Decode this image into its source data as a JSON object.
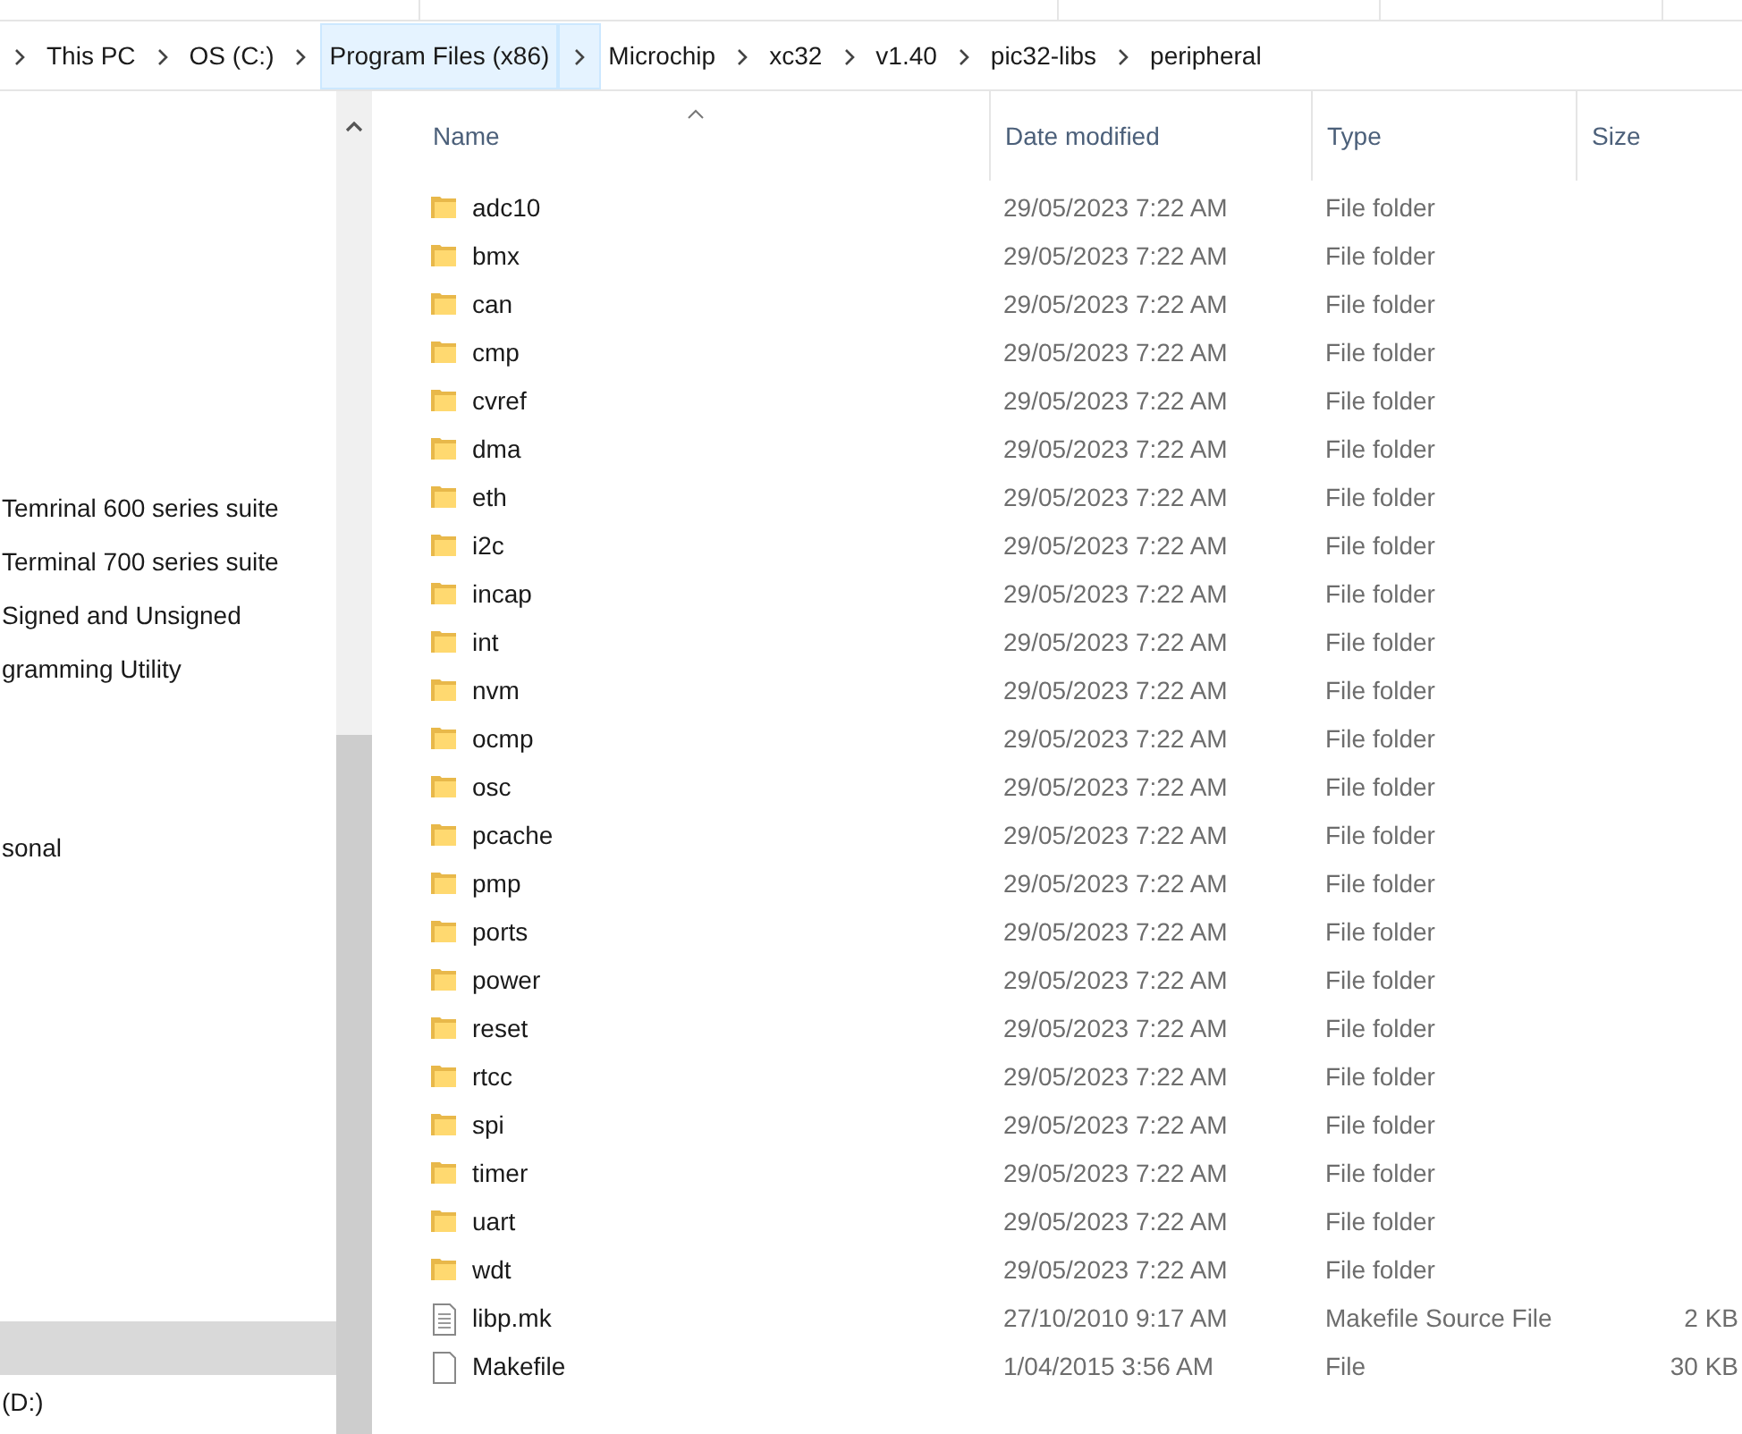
{
  "breadcrumb": [
    {
      "label": "This PC",
      "selected": false
    },
    {
      "label": "OS (C:)",
      "selected": false
    },
    {
      "label": "Program Files (x86)",
      "selected": true
    },
    {
      "label": "Microchip",
      "selected": false
    },
    {
      "label": "xc32",
      "selected": false
    },
    {
      "label": "v1.40",
      "selected": false
    },
    {
      "label": "pic32-libs",
      "selected": false
    },
    {
      "label": "peripheral",
      "selected": false
    }
  ],
  "navigation_pane": {
    "items": [
      {
        "label": "Temrinal 600 series suite",
        "selected": false
      },
      {
        "label": "Terminal 700 series suite",
        "selected": false
      },
      {
        "label": "Signed and Unsigned",
        "selected": false
      },
      {
        "label": "gramming Utility",
        "selected": false
      },
      {
        "label": "sonal",
        "selected": false
      },
      {
        "selected": true
      },
      {
        "label": "(D:)",
        "selected": false
      }
    ]
  },
  "file_list": {
    "columns": [
      "Name",
      "Date modified",
      "Type",
      "Size"
    ],
    "rows": [
      {
        "kind": "folder",
        "name": "adc10",
        "date": "29/05/2023 7:22 AM",
        "type": "File folder"
      },
      {
        "kind": "folder",
        "name": "bmx",
        "date": "29/05/2023 7:22 AM",
        "type": "File folder"
      },
      {
        "kind": "folder",
        "name": "can",
        "date": "29/05/2023 7:22 AM",
        "type": "File folder"
      },
      {
        "kind": "folder",
        "name": "cmp",
        "date": "29/05/2023 7:22 AM",
        "type": "File folder"
      },
      {
        "kind": "folder",
        "name": "cvref",
        "date": "29/05/2023 7:22 AM",
        "type": "File folder"
      },
      {
        "kind": "folder",
        "name": "dma",
        "date": "29/05/2023 7:22 AM",
        "type": "File folder"
      },
      {
        "kind": "folder",
        "name": "eth",
        "date": "29/05/2023 7:22 AM",
        "type": "File folder"
      },
      {
        "kind": "folder",
        "name": "i2c",
        "date": "29/05/2023 7:22 AM",
        "type": "File folder"
      },
      {
        "kind": "folder",
        "name": "incap",
        "date": "29/05/2023 7:22 AM",
        "type": "File folder"
      },
      {
        "kind": "folder",
        "name": "int",
        "date": "29/05/2023 7:22 AM",
        "type": "File folder"
      },
      {
        "kind": "folder",
        "name": "nvm",
        "date": "29/05/2023 7:22 AM",
        "type": "File folder"
      },
      {
        "kind": "folder",
        "name": "ocmp",
        "date": "29/05/2023 7:22 AM",
        "type": "File folder"
      },
      {
        "kind": "folder",
        "name": "osc",
        "date": "29/05/2023 7:22 AM",
        "type": "File folder"
      },
      {
        "kind": "folder",
        "name": "pcache",
        "date": "29/05/2023 7:22 AM",
        "type": "File folder"
      },
      {
        "kind": "folder",
        "name": "pmp",
        "date": "29/05/2023 7:22 AM",
        "type": "File folder"
      },
      {
        "kind": "folder",
        "name": "ports",
        "date": "29/05/2023 7:22 AM",
        "type": "File folder"
      },
      {
        "kind": "folder",
        "name": "power",
        "date": "29/05/2023 7:22 AM",
        "type": "File folder"
      },
      {
        "kind": "folder",
        "name": "reset",
        "date": "29/05/2023 7:22 AM",
        "type": "File folder"
      },
      {
        "kind": "folder",
        "name": "rtcc",
        "date": "29/05/2023 7:22 AM",
        "type": "File folder"
      },
      {
        "kind": "folder",
        "name": "spi",
        "date": "29/05/2023 7:22 AM",
        "type": "File folder"
      },
      {
        "kind": "folder",
        "name": "timer",
        "date": "29/05/2023 7:22 AM",
        "type": "File folder"
      },
      {
        "kind": "folder",
        "name": "uart",
        "date": "29/05/2023 7:22 AM",
        "type": "File folder"
      },
      {
        "kind": "folder",
        "name": "wdt",
        "date": "29/05/2023 7:22 AM",
        "type": "File folder"
      },
      {
        "kind": "text_file",
        "name": "libp.mk",
        "date": "27/10/2010 9:17 AM",
        "type": "Makefile Source File",
        "size": "2 KB"
      },
      {
        "kind": "file",
        "name": "Makefile",
        "date": "1/04/2015 3:56 AM",
        "type": "File",
        "size": "30 KB"
      }
    ]
  }
}
